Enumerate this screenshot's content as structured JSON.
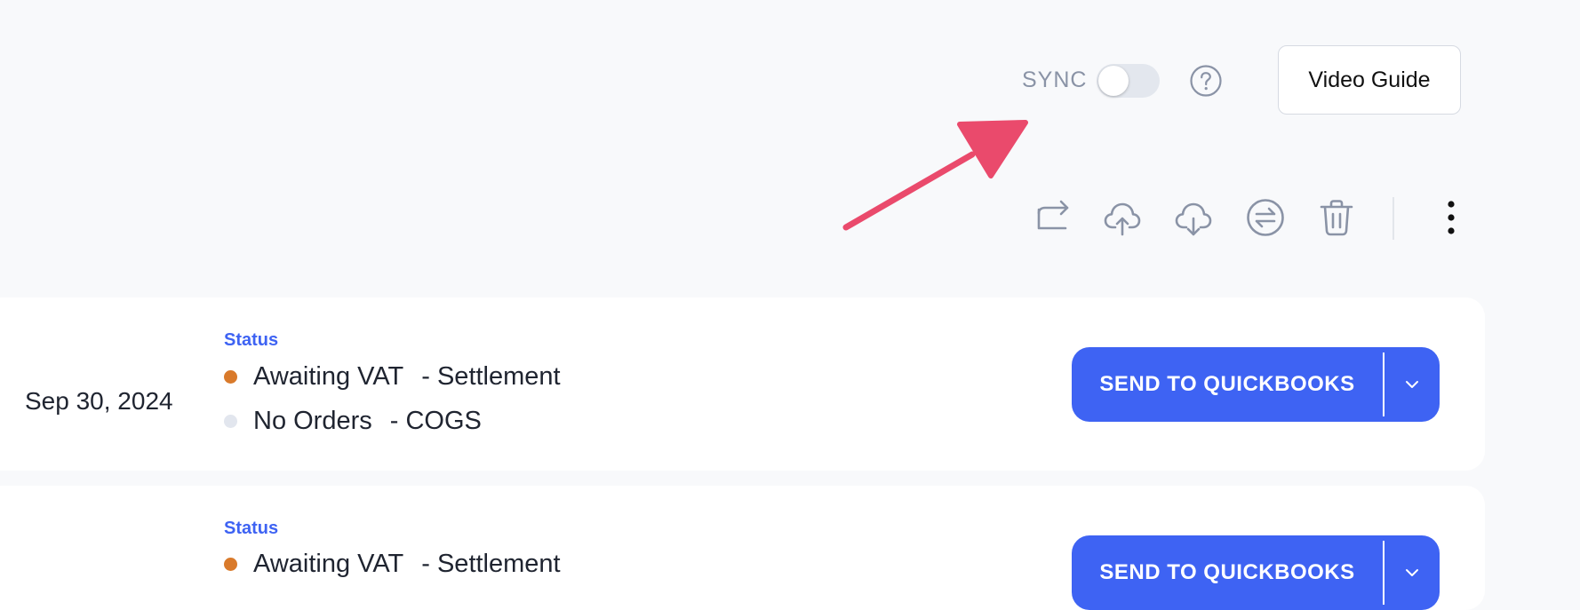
{
  "header": {
    "sync_label": "SYNC",
    "sync_enabled": false,
    "help_icon": "question-circle-icon",
    "video_guide_label": "Video Guide"
  },
  "toolbar": {
    "icons": [
      "share-forward-icon",
      "cloud-upload-icon",
      "cloud-download-icon",
      "swap-circle-icon",
      "trash-icon",
      "more-vertical-icon"
    ]
  },
  "rows": [
    {
      "date": "Sep 30, 2024",
      "status_heading": "Status",
      "statuses": [
        {
          "state": "Awaiting VAT",
          "type": "Settlement",
          "dot_color": "#d97a2b"
        },
        {
          "state": "No Orders",
          "type": "COGS",
          "dot_color": "#e2e6ee"
        }
      ],
      "send_label": "SEND TO QUICKBOOKS"
    },
    {
      "date": "",
      "status_heading": "Status",
      "statuses": [
        {
          "state": "Awaiting VAT",
          "type": "Settlement",
          "dot_color": "#d97a2b"
        }
      ],
      "send_label": "SEND TO QUICKBOOKS"
    }
  ],
  "colors": {
    "accent": "#3e63f3",
    "annotation_arrow": "#ea4a6c",
    "icon_gray": "#8a93a6",
    "background": "#f8f9fb"
  }
}
